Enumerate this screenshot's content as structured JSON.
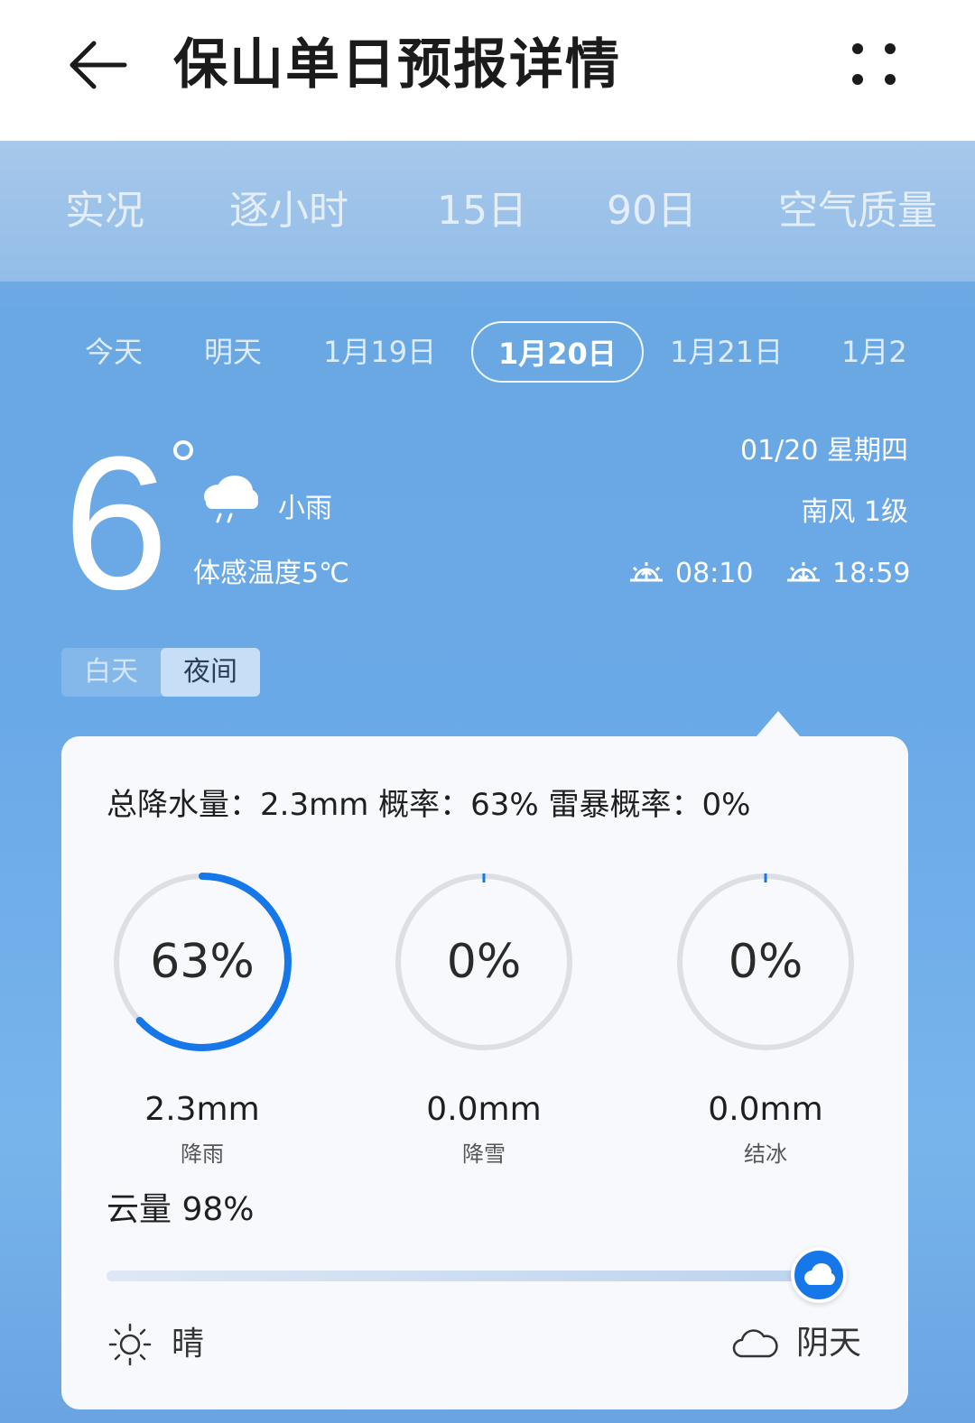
{
  "header": {
    "title": "保山单日预报详情"
  },
  "main_tabs": [
    "实况",
    "逐小时",
    "15日",
    "90日",
    "空气质量"
  ],
  "date_tabs": [
    "今天",
    "明天",
    "1月19日",
    "1月20日",
    "1月21日",
    "1月2"
  ],
  "selected_date_index": 3,
  "current": {
    "temperature": "6",
    "condition": "小雨",
    "feels_like": "体感温度5℃",
    "date": "01/20 星期四",
    "wind": "南风 1级",
    "sunrise": "08:10",
    "sunset": "18:59"
  },
  "toggle": {
    "day": "白天",
    "night": "夜间",
    "selected": "night"
  },
  "precip": {
    "summary": "总降水量：2.3mm   概率：63%   雷暴概率：0%",
    "rings": [
      {
        "percent_label": "63%",
        "value": 0.63,
        "amount": "2.3mm",
        "label": "降雨",
        "color": "#1677e8"
      },
      {
        "percent_label": "0%",
        "value": 0,
        "amount": "0.0mm",
        "label": "降雪",
        "color": "#1677e8"
      },
      {
        "percent_label": "0%",
        "value": 0,
        "amount": "0.0mm",
        "label": "结冰",
        "color": "#1677e8"
      }
    ]
  },
  "cloud": {
    "title": "云量 98%",
    "value": 0.98,
    "left_label": "晴",
    "right_label": "阴天"
  },
  "colors": {
    "accent": "#1677e8",
    "ring_track": "#dcdfe4"
  }
}
